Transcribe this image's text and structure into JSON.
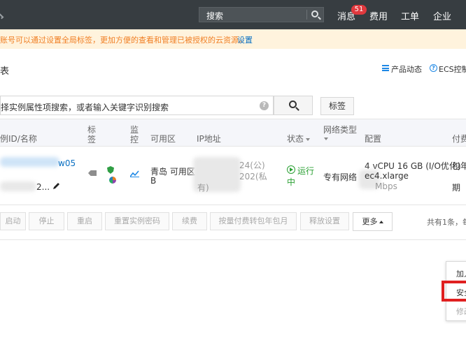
{
  "topbar": {
    "search_placeholder": "搜索",
    "nav": {
      "messages": "消息",
      "messages_count": "51",
      "billing": "费用",
      "tickets": "工单",
      "enterprise": "企业"
    }
  },
  "notice": {
    "message": "账号可以通过设置全局标签，更加方便的查看和管理已被授权的云资源。",
    "link": "设置"
  },
  "header": {
    "title": "表",
    "product_news": "产品动态",
    "ecs_console": "ECS控制"
  },
  "search": {
    "placeholder": "择实例属性项搜索，或者输入关键字识别搜索",
    "tag_button": "标签"
  },
  "table": {
    "columns": {
      "id_name": "例ID/名称",
      "tag_line1": "标",
      "tag_line2": "签",
      "monitor_line1": "监",
      "monitor_line2": "控",
      "zone": "可用区",
      "ip": "IP地址",
      "status": "状态",
      "network_line1": "网络类型",
      "config": "配置",
      "payment": "付费"
    },
    "row": {
      "id_suffix": "w05",
      "name_suffix": "2...",
      "zone_line1": "青岛 可用区",
      "zone_line2": "B",
      "ip_public": "24(公)",
      "ip_private": "202(私",
      "ip_private_line2": "有)",
      "status_line1": "运行",
      "status_line2": "中",
      "network": "专有网络",
      "config_line1": "4 vCPU 16 GB (I/O优化)",
      "config_line2": "ec4.xlarge",
      "config_line3": "Mbps",
      "payment_line1": "包年",
      "payment_line2": "期"
    }
  },
  "actions": {
    "start": "启动",
    "stop": "停止",
    "restart": "重启",
    "reset_password": "重置实例密码",
    "renew": "续费",
    "convert_billing": "按量付费转包年包月",
    "release_settings": "释放设置",
    "more": "更多",
    "total": "共有1条，每"
  },
  "dropdown": {
    "item1": "加入",
    "item2": "安全",
    "item3": "修改"
  }
}
